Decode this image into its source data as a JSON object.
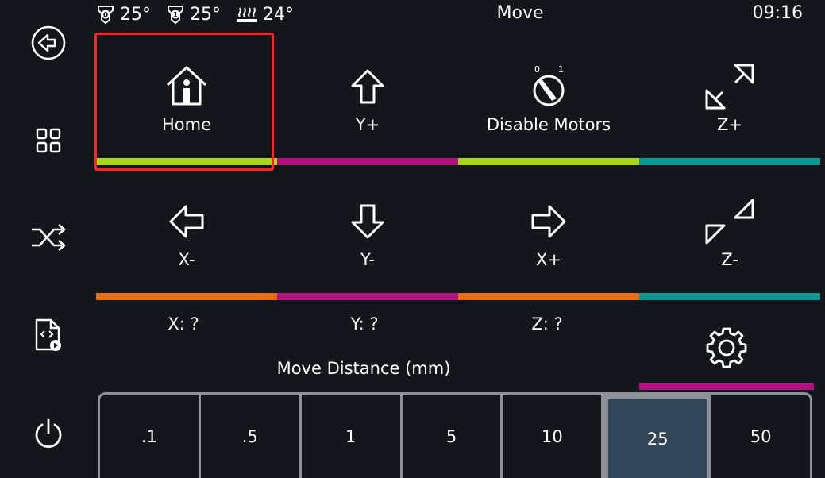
{
  "header": {
    "title": "Move",
    "time": "09:16"
  },
  "temps": [
    {
      "icon": "extruder-0-icon",
      "value": "25°"
    },
    {
      "icon": "extruder-1-icon",
      "value": "25°"
    },
    {
      "icon": "heated-bed-icon",
      "value": "24°"
    }
  ],
  "sidebar": [
    {
      "name": "back-icon"
    },
    {
      "name": "menu-grid-icon"
    },
    {
      "name": "shuffle-icon"
    },
    {
      "name": "gcode-file-icon"
    },
    {
      "name": "power-icon"
    }
  ],
  "tiles": [
    {
      "label": "Home",
      "icon": "home-icon",
      "color": "#a6d51b"
    },
    {
      "label": "Y+",
      "icon": "arrow-up-icon",
      "color": "#b0137e"
    },
    {
      "label": "Disable Motors",
      "icon": "motor-switch-icon",
      "color": "#a6d51b"
    },
    {
      "label": "Z+",
      "icon": "z-up-icon",
      "color": "#0a9990"
    },
    {
      "label": "X-",
      "icon": "arrow-left-icon",
      "color": "#ea6c0c"
    },
    {
      "label": "Y-",
      "icon": "arrow-down-icon",
      "color": "#b0137e"
    },
    {
      "label": "X+",
      "icon": "arrow-right-icon",
      "color": "#ea6c0c"
    },
    {
      "label": "Z-",
      "icon": "z-down-icon",
      "color": "#0a9990"
    }
  ],
  "positions": {
    "x": "X: ?",
    "y": "Y: ?",
    "z": "Z: ?"
  },
  "settings": {
    "icon": "gear-icon",
    "color": "#b0137e"
  },
  "distance": {
    "label": "Move Distance (mm)",
    "options": [
      ".1",
      ".5",
      "1",
      "5",
      "10",
      "25",
      "50"
    ],
    "selected": "25"
  }
}
